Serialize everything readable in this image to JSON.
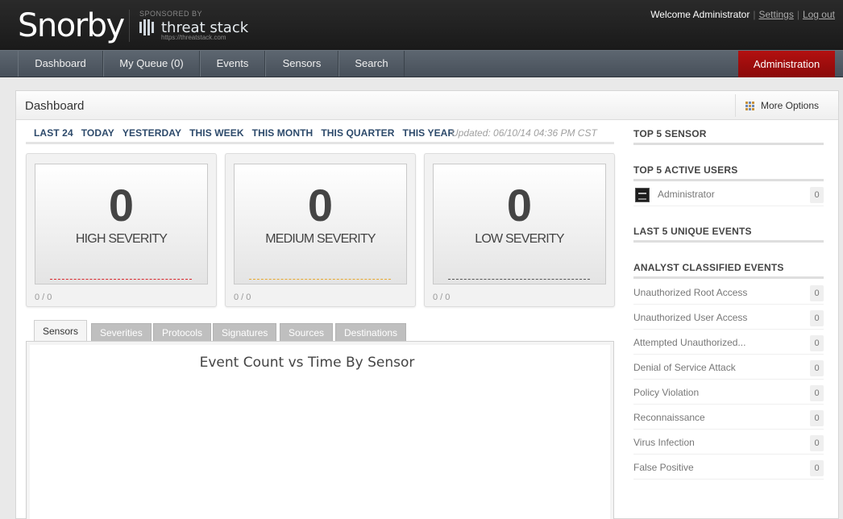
{
  "header": {
    "logo": "Snorby",
    "sponsor": "SPONSORED BY",
    "sponsor_name": "threat stack",
    "sponsor_url": "https://threatstack.com",
    "welcome": "Welcome Administrator",
    "settings": "Settings",
    "logout": "Log out"
  },
  "nav": {
    "items": [
      "Dashboard",
      "My Queue (0)",
      "Events",
      "Sensors",
      "Search"
    ],
    "admin": "Administration"
  },
  "dashboard": {
    "title": "Dashboard",
    "more_options": "More Options",
    "ranges": [
      "LAST 24",
      "TODAY",
      "YESTERDAY",
      "THIS WEEK",
      "THIS MONTH",
      "THIS QUARTER",
      "THIS YEAR"
    ],
    "updated": "Updated: 06/10/14 04:36 PM CST",
    "severities": [
      {
        "count": "0",
        "label": "HIGH SEVERITY",
        "ratio": "0 / 0",
        "color": "#d9262b"
      },
      {
        "count": "0",
        "label": "MEDIUM SEVERITY",
        "ratio": "0 / 0",
        "color": "#e6a72e"
      },
      {
        "count": "0",
        "label": "LOW SEVERITY",
        "ratio": "0 / 0",
        "color": "#555555"
      }
    ],
    "tabs": [
      "Sensors",
      "Severities",
      "Protocols",
      "Signatures",
      "Sources",
      "Destinations"
    ],
    "chart_title": "Event Count vs Time By Sensor"
  },
  "sidebar": {
    "top_sensor": "TOP 5 SENSOR",
    "top_users": "TOP 5 ACTIVE USERS",
    "users": [
      {
        "name": "Administrator",
        "count": "0"
      }
    ],
    "unique_events": "LAST 5 UNIQUE EVENTS",
    "classified": "ANALYST CLASSIFIED EVENTS",
    "classifications": [
      {
        "label": "Unauthorized Root Access",
        "count": "0"
      },
      {
        "label": "Unauthorized User Access",
        "count": "0"
      },
      {
        "label": "Attempted Unauthorized...",
        "count": "0"
      },
      {
        "label": "Denial of Service Attack",
        "count": "0"
      },
      {
        "label": "Policy Violation",
        "count": "0"
      },
      {
        "label": "Reconnaissance",
        "count": "0"
      },
      {
        "label": "Virus Infection",
        "count": "0"
      },
      {
        "label": "False Positive",
        "count": "0"
      }
    ]
  }
}
